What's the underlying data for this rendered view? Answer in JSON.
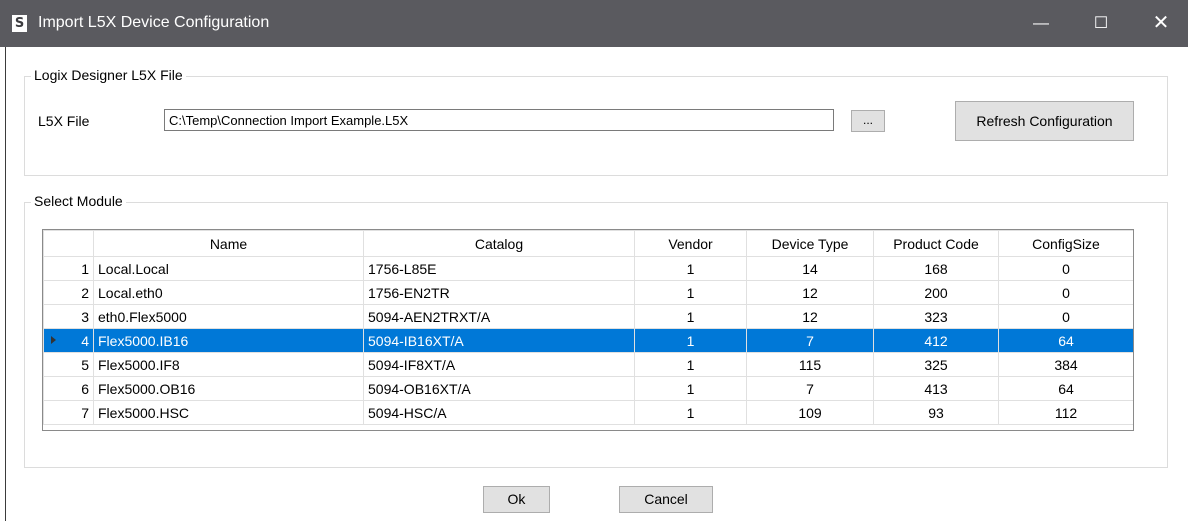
{
  "window": {
    "title": "Import L5X Device Configuration",
    "icon_letter": "S",
    "controls": {
      "minimize": "—",
      "maximize": "☐",
      "close": "✕"
    }
  },
  "file_group": {
    "legend": "Logix Designer L5X File",
    "file_label": "L5X File",
    "file_value": "C:\\Temp\\Connection Import Example.L5X",
    "browse_label": "...",
    "refresh_label": "Refresh Configuration"
  },
  "module_group": {
    "legend": "Select Module",
    "columns": [
      "",
      "Name",
      "Catalog",
      "Vendor",
      "Device Type",
      "Product Code",
      "ConfigSize"
    ],
    "selected_row": 3,
    "rows": [
      {
        "idx": "1",
        "name": "Local.Local",
        "catalog": "1756-L85E",
        "vendor": "1",
        "device_type": "14",
        "product_code": "168",
        "config_size": "0"
      },
      {
        "idx": "2",
        "name": "Local.eth0",
        "catalog": "1756-EN2TR",
        "vendor": "1",
        "device_type": "12",
        "product_code": "200",
        "config_size": "0"
      },
      {
        "idx": "3",
        "name": "eth0.Flex5000",
        "catalog": "5094-AEN2TRXT/A",
        "vendor": "1",
        "device_type": "12",
        "product_code": "323",
        "config_size": "0"
      },
      {
        "idx": "4",
        "name": "Flex5000.IB16",
        "catalog": "5094-IB16XT/A",
        "vendor": "1",
        "device_type": "7",
        "product_code": "412",
        "config_size": "64"
      },
      {
        "idx": "5",
        "name": "Flex5000.IF8",
        "catalog": "5094-IF8XT/A",
        "vendor": "1",
        "device_type": "115",
        "product_code": "325",
        "config_size": "384"
      },
      {
        "idx": "6",
        "name": "Flex5000.OB16",
        "catalog": "5094-OB16XT/A",
        "vendor": "1",
        "device_type": "7",
        "product_code": "413",
        "config_size": "64"
      },
      {
        "idx": "7",
        "name": "Flex5000.HSC",
        "catalog": "5094-HSC/A",
        "vendor": "1",
        "device_type": "109",
        "product_code": "93",
        "config_size": "112"
      }
    ]
  },
  "footer": {
    "ok_label": "Ok",
    "cancel_label": "Cancel"
  },
  "colors": {
    "titlebar": "#5a5a5f",
    "selection": "#0078d7"
  }
}
